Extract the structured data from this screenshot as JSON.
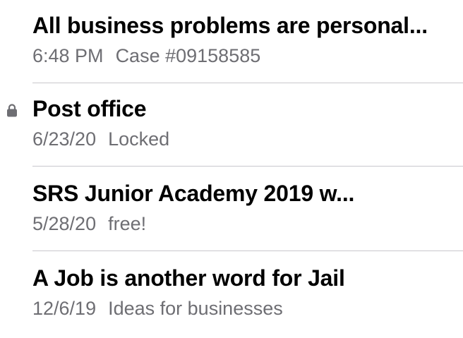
{
  "notes": [
    {
      "title": "All business problems are personal...",
      "date": "6:48 PM",
      "preview": "Case #09158585",
      "locked": false
    },
    {
      "title": "Post office",
      "date": "6/23/20",
      "preview": "Locked",
      "locked": true,
      "icon": "lock-icon"
    },
    {
      "title": "SRS Junior Academy 2019 w...",
      "date": "5/28/20",
      "preview": "free!",
      "locked": false
    },
    {
      "title": "A Job is another word for Jail",
      "date": "12/6/19",
      "preview": "Ideas for businesses",
      "locked": false
    }
  ],
  "colors": {
    "title": "#000000",
    "meta": "#6e6e73",
    "divider": "#c8c7cc",
    "lock": "#6e6e73"
  }
}
